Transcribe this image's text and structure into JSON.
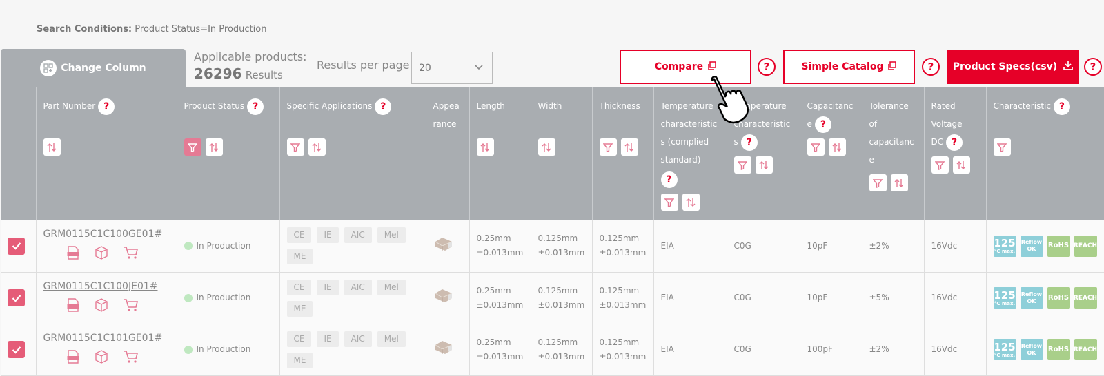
{
  "search": {
    "label": "Search Conditions:",
    "value": "Product Status=In Production"
  },
  "toolbar": {
    "change_column": "Change Column",
    "applicable_label": "Applicable products:",
    "count": "26296",
    "results_word": "Results",
    "rpp_label": "Results per page:",
    "rpp_value": "20",
    "compare": "Compare",
    "simple_catalog": "Simple Catalog",
    "product_specs": "Product Specs(csv)",
    "help": "?"
  },
  "headers": {
    "part_number": "Part Number",
    "product_status": "Product Status",
    "specific_applications": "Specific Applications",
    "appearance_1": "Appea",
    "appearance_2": "rance",
    "length": "Length",
    "width": "Width",
    "thickness": "Thickness",
    "temp_std_1": "Temperature",
    "temp_std_2": "characteristic",
    "temp_std_3": "s (complied",
    "temp_std_4": "standard)",
    "temp_char_1": "Temperature",
    "temp_char_2": "characteristic",
    "temp_char_3": "s",
    "capacitance_1": "Capacitanc",
    "capacitance_2": "e",
    "tolerance_1": "Tolerance",
    "tolerance_2": "of",
    "tolerance_3": "capacitanc",
    "tolerance_4": "e",
    "rated_1": "Rated",
    "rated_2": "Voltage",
    "rated_3": "DC",
    "characteristic": "Characteristic"
  },
  "badges": {
    "temp_big": "125",
    "temp_small": "°C max.",
    "reflow_1": "Reflow",
    "reflow_2": "OK",
    "rohs": "RoHS",
    "reach": "REACH"
  },
  "rows": [
    {
      "part": "GRM0115C1C100GE01#",
      "status": "In Production",
      "apps": [
        "CE",
        "IE",
        "AIC",
        "Mel",
        "ME"
      ],
      "length_1": "0.25mm",
      "length_2": "±0.013mm",
      "width_1": "0.125mm",
      "width_2": "±0.013mm",
      "thickness_1": "0.125mm",
      "thickness_2": "±0.013mm",
      "temp_std": "EIA",
      "temp_char": "C0G",
      "capacitance": "10pF",
      "tolerance": "±2%",
      "rated": "16Vdc"
    },
    {
      "part": "GRM0115C1C100JE01#",
      "status": "In Production",
      "apps": [
        "CE",
        "IE",
        "AIC",
        "Mel",
        "ME"
      ],
      "length_1": "0.25mm",
      "length_2": "±0.013mm",
      "width_1": "0.125mm",
      "width_2": "±0.013mm",
      "thickness_1": "0.125mm",
      "thickness_2": "±0.013mm",
      "temp_std": "EIA",
      "temp_char": "C0G",
      "capacitance": "10pF",
      "tolerance": "±5%",
      "rated": "16Vdc"
    },
    {
      "part": "GRM0115C1C101GE01#",
      "status": "In Production",
      "apps": [
        "CE",
        "IE",
        "AIC",
        "Mel",
        "ME"
      ],
      "length_1": "0.25mm",
      "length_2": "±0.013mm",
      "width_1": "0.125mm",
      "width_2": "±0.013mm",
      "thickness_1": "0.125mm",
      "thickness_2": "±0.013mm",
      "temp_std": "EIA",
      "temp_char": "C0G",
      "capacitance": "100pF",
      "tolerance": "±2%",
      "rated": "16Vdc"
    }
  ],
  "colors": {
    "accent": "#e60028",
    "header_bg": "#a9adb1",
    "checkbox": "#e55c78"
  }
}
